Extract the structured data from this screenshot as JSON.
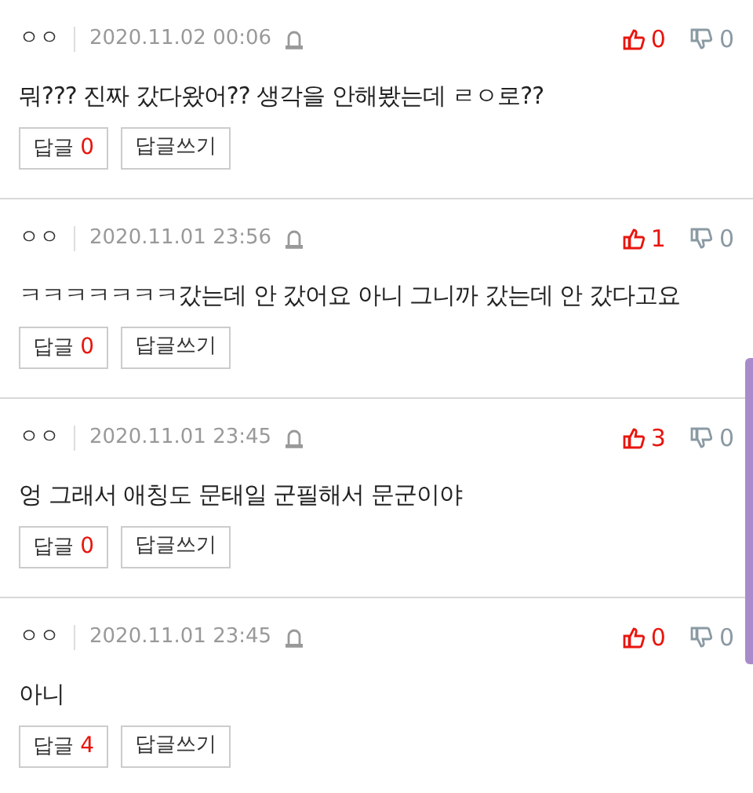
{
  "comments": [
    {
      "author": "ㅇㅇ",
      "date": "2020.11.02 00:06",
      "body": "뭐??? 진짜 갔다왔어?? 생각을 안해봤는데 ㄹㅇ로??",
      "likes": "0",
      "dislikes": "0",
      "reply_label": "답글",
      "reply_count": "0",
      "write_label": "답글쓰기"
    },
    {
      "author": "ㅇㅇ",
      "date": "2020.11.01 23:56",
      "body": "ㅋㅋㅋㅋㅋㅋㅋ갔는데 안 갔어요 아니 그니까 갔는데 안 갔다고요",
      "likes": "1",
      "dislikes": "0",
      "reply_label": "답글",
      "reply_count": "0",
      "write_label": "답글쓰기"
    },
    {
      "author": "ㅇㅇ",
      "date": "2020.11.01 23:45",
      "body": "엉 그래서 애칭도 문태일 군필해서 문군이야",
      "likes": "3",
      "dislikes": "0",
      "reply_label": "답글",
      "reply_count": "0",
      "write_label": "답글쓰기"
    },
    {
      "author": "ㅇㅇ",
      "date": "2020.11.01 23:45",
      "body": "아니",
      "likes": "0",
      "dislikes": "0",
      "reply_label": "답글",
      "reply_count": "4",
      "write_label": "답글쓰기"
    }
  ]
}
